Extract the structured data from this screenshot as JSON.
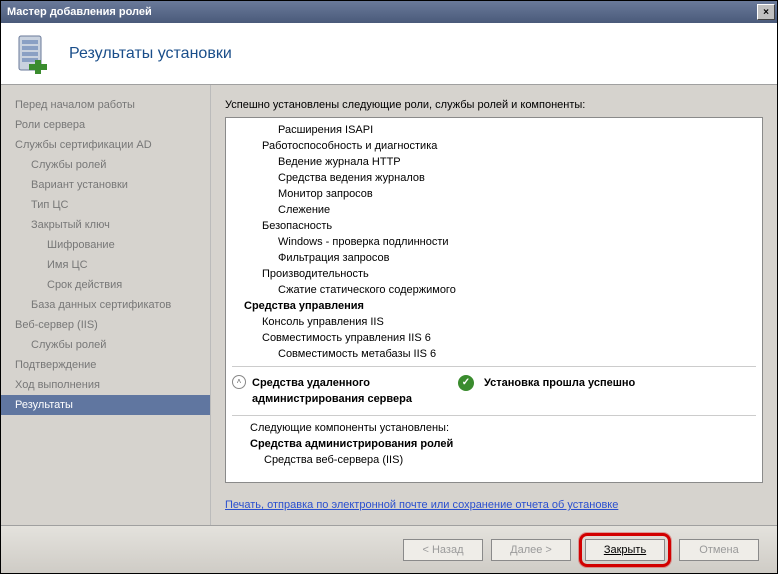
{
  "window": {
    "title": "Мастер добавления ролей",
    "close": "×"
  },
  "header": {
    "title": "Результаты установки"
  },
  "sidebar": {
    "items": [
      {
        "label": "Перед началом работы",
        "level": 0
      },
      {
        "label": "Роли сервера",
        "level": 0
      },
      {
        "label": "Службы сертификации AD",
        "level": 0
      },
      {
        "label": "Службы ролей",
        "level": 1
      },
      {
        "label": "Вариант установки",
        "level": 1
      },
      {
        "label": "Тип ЦС",
        "level": 1
      },
      {
        "label": "Закрытый ключ",
        "level": 1
      },
      {
        "label": "Шифрование",
        "level": 2
      },
      {
        "label": "Имя ЦС",
        "level": 2
      },
      {
        "label": "Срок действия",
        "level": 2
      },
      {
        "label": "База данных сертификатов",
        "level": 1
      },
      {
        "label": "Веб-сервер (IIS)",
        "level": 0
      },
      {
        "label": "Службы ролей",
        "level": 1
      },
      {
        "label": "Подтверждение",
        "level": 0
      },
      {
        "label": "Ход выполнения",
        "level": 0
      },
      {
        "label": "Результаты",
        "level": 0,
        "selected": true
      }
    ]
  },
  "main": {
    "intro": "Успешно установлены следующие роли, службы ролей и компоненты:",
    "treeLines": [
      {
        "indent": "l1",
        "text": "Расширения ISAPI"
      },
      {
        "indent": "l2",
        "text": "Работоспособность и диагностика"
      },
      {
        "indent": "l1",
        "text": "Ведение журнала HTTP"
      },
      {
        "indent": "l1",
        "text": "Средства ведения журналов"
      },
      {
        "indent": "l1",
        "text": "Монитор запросов"
      },
      {
        "indent": "l1",
        "text": "Слежение"
      },
      {
        "indent": "l2",
        "text": "Безопасность"
      },
      {
        "indent": "l1",
        "text": "Windows - проверка подлинности"
      },
      {
        "indent": "l1",
        "text": "Фильтрация запросов"
      },
      {
        "indent": "l2",
        "text": "Производительность"
      },
      {
        "indent": "l1",
        "text": "Сжатие статического содержимого"
      },
      {
        "indent": "bold",
        "text": "Средства управления"
      },
      {
        "indent": "l2",
        "text": "Консоль управления IIS"
      },
      {
        "indent": "l2",
        "text": "Совместимость управления IIS 6"
      },
      {
        "indent": "l1",
        "text": "Совместимость метабазы IIS 6"
      }
    ],
    "status": {
      "label": "Средства удаленного администрирования сервера",
      "ok": "Установка прошла успешно"
    },
    "sub": {
      "line1": "Следующие компоненты установлены:",
      "line2": "Средства администрирования ролей",
      "line3": "Средства веб-сервера (IIS)"
    },
    "link": "Печать, отправка по электронной почте или сохранение отчета об установке"
  },
  "footer": {
    "back": "< Назад",
    "next": "Далее >",
    "close": "Закрыть",
    "cancel": "Отмена"
  }
}
